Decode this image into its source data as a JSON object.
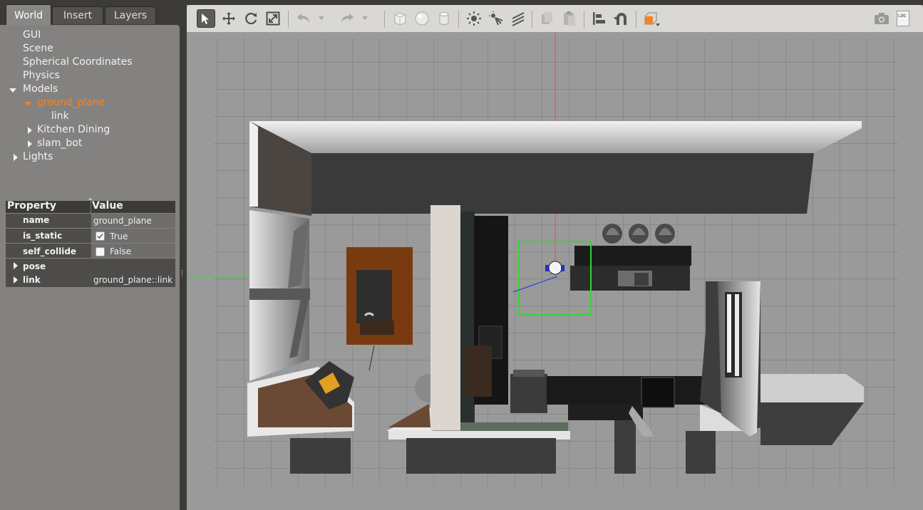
{
  "tabs": {
    "world": "World",
    "insert": "Insert",
    "layers": "Layers"
  },
  "tree": {
    "gui": "GUI",
    "scene": "Scene",
    "spherical": "Spherical Coordinates",
    "physics": "Physics",
    "models": "Models",
    "ground_plane": "ground_plane",
    "link": "link",
    "kitchen_dining": "Kitchen Dining",
    "slam_bot": "slam_bot",
    "lights": "Lights"
  },
  "properties": {
    "header_property": "Property",
    "header_value": "Value",
    "name_key": "name",
    "name_val": "ground_plane",
    "is_static_key": "is_static",
    "is_static_val": "True",
    "is_static_checked": true,
    "self_collide_key": "self_collide",
    "self_collide_val": "False",
    "self_collide_checked": false,
    "pose_key": "pose",
    "link_key": "link",
    "link_val": "ground_plane::link"
  },
  "toolbar": {
    "log_label": "LOG",
    "icons": [
      "select-icon",
      "translate-icon",
      "rotate-icon",
      "scale-icon",
      "undo-icon",
      "redo-icon",
      "box-icon",
      "sphere-icon",
      "cylinder-icon",
      "point-light-icon",
      "spot-light-icon",
      "directional-light-icon",
      "copy-icon",
      "paste-icon",
      "align-icon",
      "snap-icon",
      "view-angle-icon",
      "screenshot-icon",
      "log-icon"
    ]
  },
  "colors": {
    "selection": "#f58220",
    "accent": "#f58220"
  }
}
